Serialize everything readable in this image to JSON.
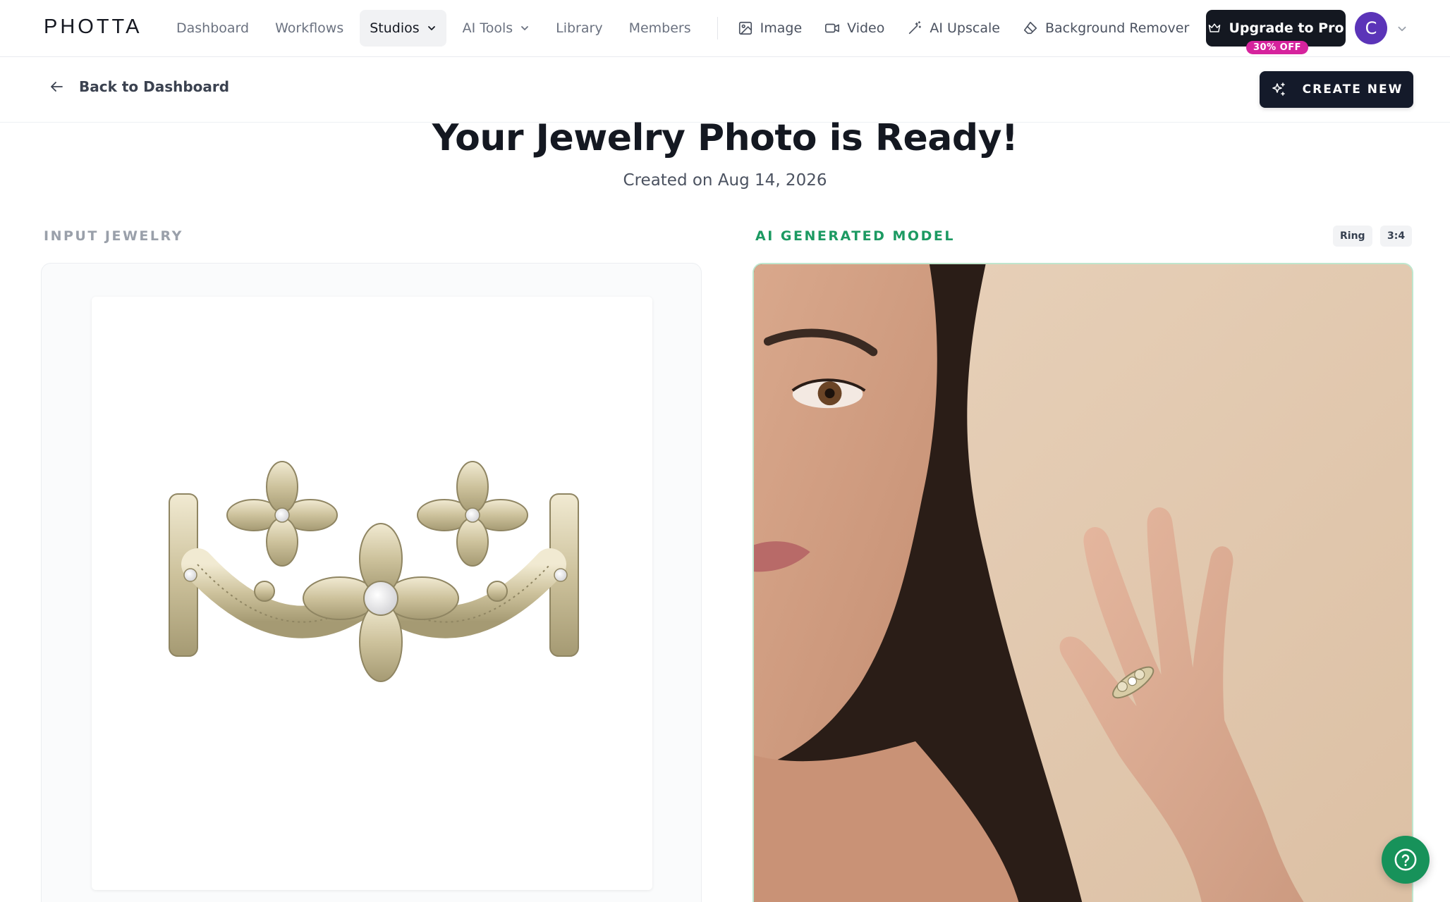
{
  "app": {
    "logo": "PHOTTA"
  },
  "nav": {
    "items": [
      {
        "label": "Dashboard",
        "active": false,
        "dropdown": false
      },
      {
        "label": "Workflows",
        "active": false,
        "dropdown": false
      },
      {
        "label": "Studios",
        "active": true,
        "dropdown": true
      },
      {
        "label": "AI Tools",
        "active": false,
        "dropdown": true
      },
      {
        "label": "Library",
        "active": false,
        "dropdown": false
      },
      {
        "label": "Members",
        "active": false,
        "dropdown": false
      }
    ],
    "tools": [
      {
        "label": "Image",
        "icon": "image-icon"
      },
      {
        "label": "Video",
        "icon": "video-icon"
      },
      {
        "label": "AI Upscale",
        "icon": "magic-wand-icon"
      },
      {
        "label": "Background Remover",
        "icon": "eraser-icon"
      }
    ],
    "upgrade_label": "Upgrade to Pro",
    "discount_label": "30% OFF",
    "avatar_initial": "C"
  },
  "subheader": {
    "back_label": "Back to Dashboard",
    "create_label": "CREATE NEW"
  },
  "page": {
    "title": "Your Jewelry Photo is Ready!",
    "created": "Created on Aug 14, 2026"
  },
  "panels": {
    "input_label": "INPUT JEWELRY",
    "ai_label": "AI GENERATED MODEL",
    "tags": [
      "Ring",
      "3:4"
    ]
  },
  "colors": {
    "accent_green": "#1c9a62",
    "dark": "#141821",
    "discount_pink": "#d6239d",
    "avatar_purple": "#5b34b8"
  }
}
